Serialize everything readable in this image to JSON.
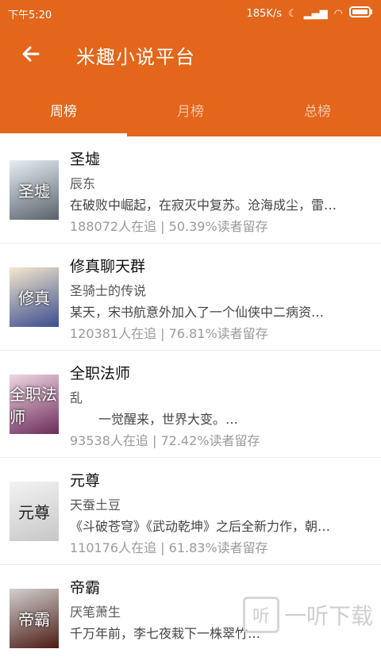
{
  "status_bar": {
    "time": "下午5:20",
    "net_speed": "185K/s"
  },
  "header": {
    "title": "米趣小说平台",
    "back_icon": "arrow-left-icon"
  },
  "tabs": [
    {
      "label": "周榜",
      "active": true
    },
    {
      "label": "月榜",
      "active": false
    },
    {
      "label": "总榜",
      "active": false
    }
  ],
  "books": [
    {
      "name": "圣墟",
      "author": "辰东",
      "desc": "在破败中崛起，在寂灭中复苏。沧海成尘，雷…",
      "stats": "188072人在追 |  50.39%读者留存",
      "cover_text": "圣墟"
    },
    {
      "name": "修真聊天群",
      "author": "圣骑士的传说",
      "desc": "某天，宋书航意外加入了一个仙侠中二病资…",
      "stats": "120381人在追 |  76.81%读者留存",
      "cover_text": "修真"
    },
    {
      "name": "全职法师",
      "author": "乱",
      "desc": "一觉醒来，世界大变。…",
      "stats": "93538人在追 |  72.42%读者留存",
      "cover_text": "全职法师"
    },
    {
      "name": "元尊",
      "author": "天蚕土豆",
      "desc": "《斗破苍穹》《武动乾坤》之后全新力作，朝…",
      "stats": "110176人在追 |  61.83%读者留存",
      "cover_text": "元尊"
    },
    {
      "name": "帝霸",
      "author": "厌笔萧生",
      "desc": "千万年前，李七夜栽下一株翠竹…",
      "stats": "",
      "cover_text": "帝霸"
    }
  ],
  "watermark": {
    "text": "一听下载",
    "icon_glyph": "听"
  },
  "colors": {
    "accent": "#e3661b"
  }
}
